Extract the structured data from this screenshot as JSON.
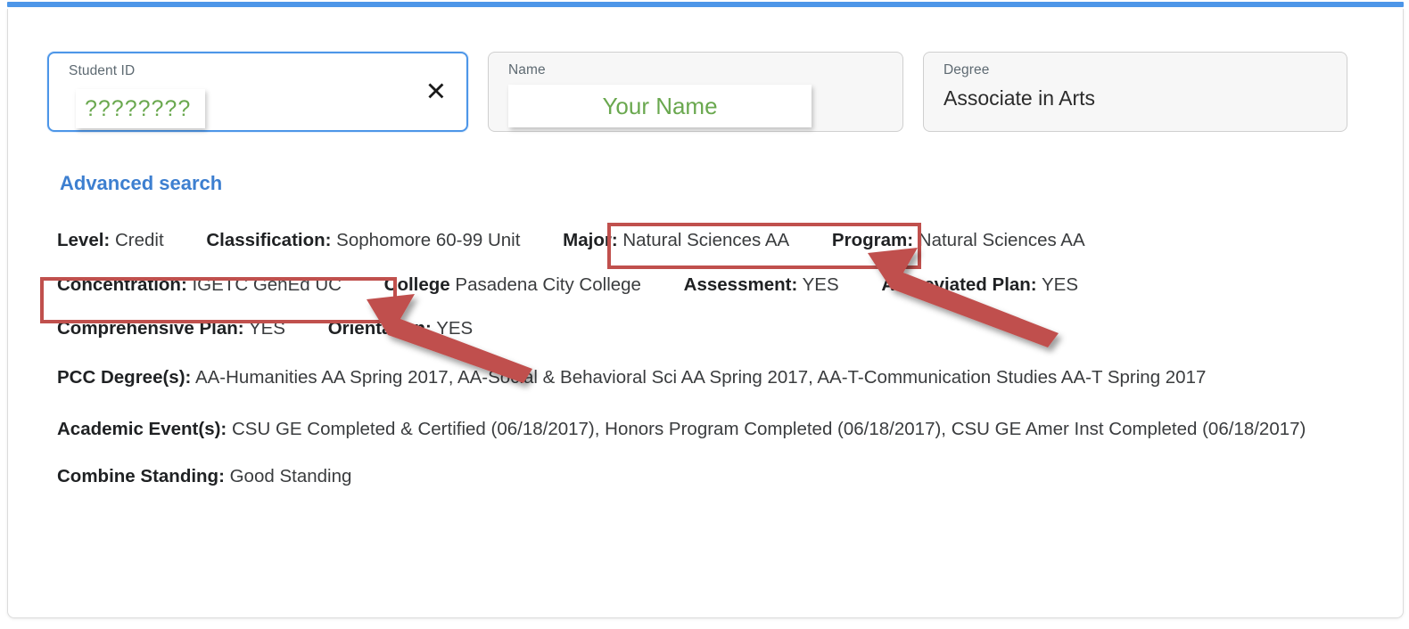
{
  "search": {
    "student_id": {
      "label": "Student ID",
      "value": "????????",
      "clear_icon": "close-x-icon"
    },
    "name": {
      "label": "Name",
      "value": "Your Name"
    },
    "degree": {
      "label": "Degree",
      "value": "Associate in Arts"
    },
    "advanced_search_label": "Advanced search"
  },
  "details": {
    "level": {
      "label": "Level:",
      "value": "Credit"
    },
    "classification": {
      "label": "Classification:",
      "value": "Sophomore 60-99 Unit"
    },
    "major": {
      "label": "Major:",
      "value": "Natural Sciences AA"
    },
    "program": {
      "label": "Program:",
      "value": "Natural Sciences AA"
    },
    "concentration": {
      "label": "Concentration:",
      "value": "IGETC GenEd UC"
    },
    "college": {
      "label": "College",
      "value": "Pasadena City College"
    },
    "assessment": {
      "label": "Assessment:",
      "value": "YES"
    },
    "abbreviated_plan": {
      "label": "Abbreviated Plan:",
      "value": "YES"
    },
    "comprehensive_plan": {
      "label": "Comprehensive Plan:",
      "value": "YES"
    },
    "orientation": {
      "label": "Orientation:",
      "value": "YES"
    },
    "pcc_degrees": {
      "label": "PCC Degree(s):",
      "value": "AA-Humanities AA Spring 2017, AA-Social & Behavioral Sci AA Spring 2017, AA-T-Communication Studies AA-T Spring 2017"
    },
    "academic_events": {
      "label": "Academic Event(s):",
      "value": "CSU GE Completed & Certified (06/18/2017), Honors Program Completed (06/18/2017), CSU GE Amer Inst Completed (06/18/2017)"
    },
    "combine_standing": {
      "label": "Combine Standing:",
      "value": "Good Standing"
    }
  },
  "annotations": {
    "box_color": "#c0504d",
    "arrow_color": "#c0504d",
    "boxed_fields": [
      "major",
      "concentration"
    ]
  },
  "colors": {
    "accent_blue": "#4d96e8",
    "link_blue": "#3d7fd0",
    "redaction_green": "#6aa84f",
    "annotation_red": "#c0504d"
  }
}
